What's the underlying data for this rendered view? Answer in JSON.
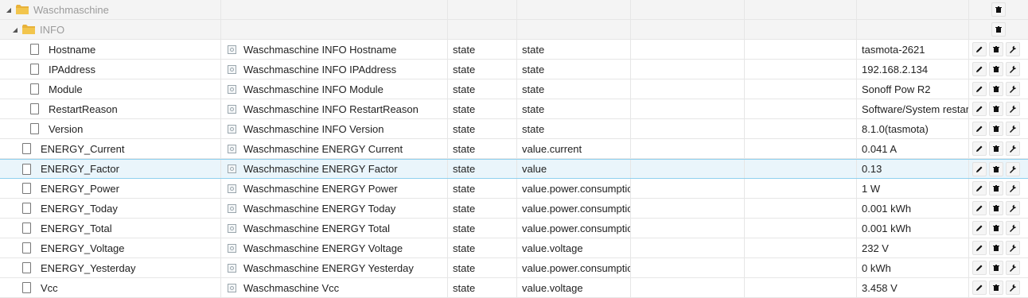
{
  "tree": {
    "folders": [
      {
        "label": "Waschmaschine"
      },
      {
        "label": "INFO"
      }
    ],
    "rows": [
      {
        "name": "Hostname",
        "title": "Waschmaschine INFO Hostname",
        "type": "state",
        "role": "state",
        "value": "tasmota-2621"
      },
      {
        "name": "IPAddress",
        "title": "Waschmaschine INFO IPAddress",
        "type": "state",
        "role": "state",
        "value": "192.168.2.134"
      },
      {
        "name": "Module",
        "title": "Waschmaschine INFO Module",
        "type": "state",
        "role": "state",
        "value": "Sonoff Pow R2"
      },
      {
        "name": "RestartReason",
        "title": "Waschmaschine INFO RestartReason",
        "type": "state",
        "role": "state",
        "value": "Software/System restar"
      },
      {
        "name": "Version",
        "title": "Waschmaschine INFO Version",
        "type": "state",
        "role": "state",
        "value": "8.1.0(tasmota)"
      },
      {
        "name": "ENERGY_Current",
        "title": "Waschmaschine ENERGY Current",
        "type": "state",
        "role": "value.current",
        "value": "0.041 A"
      },
      {
        "name": "ENERGY_Factor",
        "title": "Waschmaschine ENERGY Factor",
        "type": "state",
        "role": "value",
        "value": "0.13"
      },
      {
        "name": "ENERGY_Power",
        "title": "Waschmaschine ENERGY Power",
        "type": "state",
        "role": "value.power.consumptic",
        "value": "1 W"
      },
      {
        "name": "ENERGY_Today",
        "title": "Waschmaschine ENERGY Today",
        "type": "state",
        "role": "value.power.consumptic",
        "value": "0.001 kWh"
      },
      {
        "name": "ENERGY_Total",
        "title": "Waschmaschine ENERGY Total",
        "type": "state",
        "role": "value.power.consumptic",
        "value": "0.001 kWh"
      },
      {
        "name": "ENERGY_Voltage",
        "title": "Waschmaschine ENERGY Voltage",
        "type": "state",
        "role": "value.voltage",
        "value": "232 V"
      },
      {
        "name": "ENERGY_Yesterday",
        "title": "Waschmaschine ENERGY Yesterday",
        "type": "state",
        "role": "value.power.consumptic",
        "value": "0 kWh"
      },
      {
        "name": "Vcc",
        "title": "Waschmaschine Vcc",
        "type": "state",
        "role": "value.voltage",
        "value": "3.458 V"
      }
    ]
  },
  "icons": {
    "folder": "folder-icon",
    "file": "file-icon",
    "state": "state-icon",
    "edit": "pencil-icon",
    "delete": "trash-icon",
    "settings": "wrench-icon",
    "expand": "triangle-down-icon"
  },
  "colors": {
    "folder": "#e8b23a",
    "selected_row": "#eaf5fb",
    "selected_border": "#8fd0ee",
    "folder_label": "#9b9b9b"
  }
}
